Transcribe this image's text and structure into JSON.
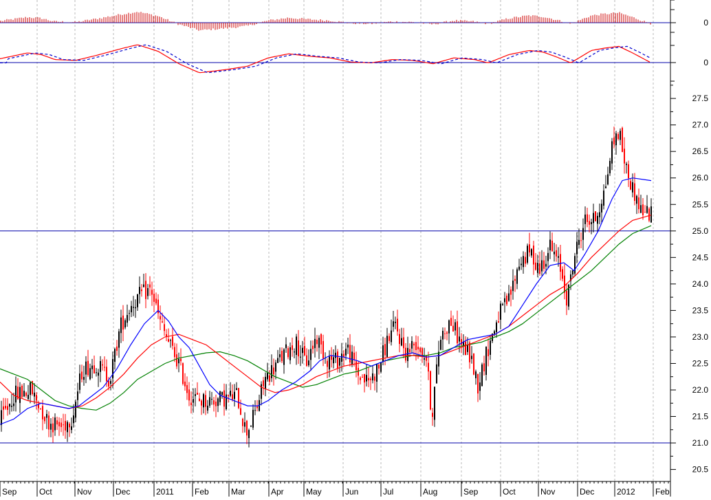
{
  "chart_data": {
    "type": "candlestick",
    "x_labels": [
      "Sep",
      "Oct",
      "Nov",
      "Dec",
      "2011",
      "Feb",
      "Mar",
      "Apr",
      "May",
      "Jun",
      "Jul",
      "Aug",
      "Sep",
      "Oct",
      "Nov",
      "Dec",
      "2012",
      "Feb"
    ],
    "price_axis": {
      "ylim": [
        20.3,
        27.8
      ],
      "ticks": [
        "20.5",
        "21.0",
        "21.5",
        "22.0",
        "22.5",
        "23.0",
        "23.5",
        "24.0",
        "24.5",
        "25.0",
        "25.5",
        "26.0",
        "26.5",
        "27.0",
        "27.5"
      ],
      "reference_lines": [
        21.0,
        25.0
      ]
    },
    "indicator_labels": [
      "0",
      "0"
    ],
    "grid": "vertical dashed",
    "colors": {
      "up_candle": "#000000",
      "down_candle": "#ff0000",
      "ma_short": "#0000ff",
      "ma_medium": "#ff0000",
      "ma_long": "#008000",
      "reference_line": "#0000aa",
      "histogram": "#cc0000",
      "signal_line": "#0000cc"
    },
    "ma_short_anchors": [
      [
        0,
        21.35
      ],
      [
        20,
        21.45
      ],
      [
        40,
        21.65
      ],
      [
        60,
        21.75
      ],
      [
        80,
        21.7
      ],
      [
        100,
        21.65
      ],
      [
        115,
        21.7
      ],
      [
        130,
        21.85
      ],
      [
        150,
        22.05
      ],
      [
        170,
        22.4
      ],
      [
        190,
        22.85
      ],
      [
        210,
        23.25
      ],
      [
        230,
        23.5
      ],
      [
        245,
        23.3
      ],
      [
        260,
        23.0
      ],
      [
        275,
        22.8
      ],
      [
        290,
        22.45
      ],
      [
        305,
        22.1
      ],
      [
        320,
        21.9
      ],
      [
        340,
        21.8
      ],
      [
        360,
        21.7
      ],
      [
        375,
        21.7
      ],
      [
        390,
        21.8
      ],
      [
        410,
        22.0
      ],
      [
        430,
        22.15
      ],
      [
        450,
        22.35
      ],
      [
        465,
        22.55
      ],
      [
        480,
        22.65
      ],
      [
        500,
        22.62
      ],
      [
        520,
        22.55
      ],
      [
        540,
        22.45
      ],
      [
        560,
        22.55
      ],
      [
        580,
        22.65
      ],
      [
        600,
        22.7
      ],
      [
        620,
        22.62
      ],
      [
        640,
        22.65
      ],
      [
        660,
        22.8
      ],
      [
        680,
        22.95
      ],
      [
        700,
        23.0
      ],
      [
        720,
        23.05
      ],
      [
        740,
        23.2
      ],
      [
        760,
        23.6
      ],
      [
        780,
        24.0
      ],
      [
        800,
        24.35
      ],
      [
        820,
        24.4
      ],
      [
        835,
        24.25
      ],
      [
        850,
        24.55
      ],
      [
        870,
        25.0
      ],
      [
        890,
        25.6
      ],
      [
        905,
        25.95
      ],
      [
        920,
        26.0
      ],
      [
        947,
        25.95
      ]
    ],
    "ma_medium_anchors": [
      [
        0,
        22.15
      ],
      [
        20,
        21.9
      ],
      [
        40,
        21.8
      ],
      [
        60,
        21.75
      ],
      [
        80,
        21.7
      ],
      [
        100,
        21.65
      ],
      [
        120,
        21.7
      ],
      [
        140,
        21.85
      ],
      [
        160,
        22.05
      ],
      [
        180,
        22.3
      ],
      [
        200,
        22.6
      ],
      [
        220,
        22.85
      ],
      [
        240,
        23.0
      ],
      [
        260,
        23.05
      ],
      [
        280,
        22.95
      ],
      [
        300,
        22.85
      ],
      [
        320,
        22.65
      ],
      [
        340,
        22.45
      ],
      [
        360,
        22.25
      ],
      [
        380,
        22.05
      ],
      [
        400,
        21.95
      ],
      [
        420,
        22.0
      ],
      [
        440,
        22.1
      ],
      [
        460,
        22.25
      ],
      [
        480,
        22.35
      ],
      [
        500,
        22.45
      ],
      [
        520,
        22.5
      ],
      [
        540,
        22.55
      ],
      [
        560,
        22.6
      ],
      [
        580,
        22.65
      ],
      [
        600,
        22.65
      ],
      [
        620,
        22.62
      ],
      [
        640,
        22.65
      ],
      [
        660,
        22.75
      ],
      [
        680,
        22.85
      ],
      [
        700,
        22.95
      ],
      [
        720,
        23.05
      ],
      [
        740,
        23.2
      ],
      [
        760,
        23.4
      ],
      [
        780,
        23.6
      ],
      [
        800,
        23.8
      ],
      [
        820,
        23.95
      ],
      [
        840,
        24.2
      ],
      [
        860,
        24.5
      ],
      [
        880,
        24.75
      ],
      [
        900,
        25.0
      ],
      [
        920,
        25.2
      ],
      [
        947,
        25.3
      ]
    ],
    "ma_long_anchors": [
      [
        0,
        22.4
      ],
      [
        20,
        22.3
      ],
      [
        40,
        22.2
      ],
      [
        60,
        22.0
      ],
      [
        80,
        21.8
      ],
      [
        100,
        21.7
      ],
      [
        120,
        21.65
      ],
      [
        140,
        21.62
      ],
      [
        160,
        21.75
      ],
      [
        180,
        21.95
      ],
      [
        200,
        22.2
      ],
      [
        220,
        22.35
      ],
      [
        240,
        22.5
      ],
      [
        260,
        22.6
      ],
      [
        280,
        22.65
      ],
      [
        300,
        22.7
      ],
      [
        320,
        22.72
      ],
      [
        340,
        22.65
      ],
      [
        360,
        22.55
      ],
      [
        380,
        22.4
      ],
      [
        400,
        22.25
      ],
      [
        420,
        22.15
      ],
      [
        440,
        22.05
      ],
      [
        460,
        22.1
      ],
      [
        480,
        22.2
      ],
      [
        500,
        22.3
      ],
      [
        520,
        22.35
      ],
      [
        540,
        22.45
      ],
      [
        560,
        22.55
      ],
      [
        580,
        22.6
      ],
      [
        600,
        22.65
      ],
      [
        620,
        22.65
      ],
      [
        640,
        22.7
      ],
      [
        660,
        22.8
      ],
      [
        680,
        22.85
      ],
      [
        700,
        22.9
      ],
      [
        720,
        23.0
      ],
      [
        740,
        23.1
      ],
      [
        760,
        23.25
      ],
      [
        780,
        23.45
      ],
      [
        800,
        23.65
      ],
      [
        820,
        23.85
      ],
      [
        840,
        24.05
      ],
      [
        860,
        24.25
      ],
      [
        880,
        24.5
      ],
      [
        900,
        24.75
      ],
      [
        920,
        24.95
      ],
      [
        947,
        25.1
      ]
    ],
    "price_anchors": [
      [
        0,
        21.4
      ],
      [
        20,
        21.9
      ],
      [
        45,
        22.0
      ],
      [
        70,
        21.4
      ],
      [
        90,
        21.3
      ],
      [
        105,
        21.5
      ],
      [
        120,
        22.4
      ],
      [
        140,
        22.5
      ],
      [
        160,
        22.2
      ],
      [
        175,
        23.2
      ],
      [
        190,
        23.6
      ],
      [
        205,
        23.8
      ],
      [
        220,
        23.9
      ],
      [
        232,
        23.3
      ],
      [
        245,
        22.9
      ],
      [
        260,
        22.5
      ],
      [
        275,
        21.9
      ],
      [
        290,
        21.8
      ],
      [
        310,
        21.8
      ],
      [
        330,
        21.85
      ],
      [
        345,
        21.9
      ],
      [
        358,
        21.2
      ],
      [
        372,
        21.6
      ],
      [
        385,
        22.2
      ],
      [
        400,
        22.45
      ],
      [
        415,
        22.7
      ],
      [
        430,
        22.9
      ],
      [
        445,
        22.5
      ],
      [
        460,
        23.0
      ],
      [
        475,
        22.6
      ],
      [
        490,
        22.55
      ],
      [
        505,
        22.8
      ],
      [
        520,
        22.3
      ],
      [
        535,
        22.15
      ],
      [
        550,
        22.4
      ],
      [
        565,
        23.0
      ],
      [
        575,
        23.2
      ],
      [
        590,
        22.7
      ],
      [
        605,
        22.9
      ],
      [
        620,
        22.6
      ],
      [
        628,
        21.5
      ],
      [
        640,
        23.0
      ],
      [
        655,
        23.3
      ],
      [
        670,
        22.9
      ],
      [
        685,
        22.6
      ],
      [
        695,
        22.1
      ],
      [
        710,
        22.8
      ],
      [
        725,
        23.4
      ],
      [
        740,
        23.7
      ],
      [
        755,
        24.4
      ],
      [
        770,
        24.6
      ],
      [
        785,
        24.3
      ],
      [
        800,
        24.7
      ],
      [
        815,
        24.3
      ],
      [
        825,
        23.7
      ],
      [
        835,
        24.5
      ],
      [
        850,
        25.2
      ],
      [
        865,
        25.2
      ],
      [
        880,
        25.8
      ],
      [
        890,
        26.6
      ],
      [
        900,
        26.9
      ],
      [
        910,
        26.2
      ],
      [
        920,
        25.8
      ],
      [
        932,
        25.4
      ],
      [
        947,
        25.3
      ]
    ],
    "macd_anchors": [
      [
        0,
        0.3
      ],
      [
        40,
        1.0
      ],
      [
        60,
        0.8
      ],
      [
        80,
        0.2
      ],
      [
        110,
        0.1
      ],
      [
        140,
        0.7
      ],
      [
        180,
        1.6
      ],
      [
        200,
        2.0
      ],
      [
        230,
        1.2
      ],
      [
        260,
        -0.3
      ],
      [
        290,
        -1.4
      ],
      [
        330,
        -1.0
      ],
      [
        360,
        -0.6
      ],
      [
        390,
        0.4
      ],
      [
        420,
        0.9
      ],
      [
        450,
        0.6
      ],
      [
        480,
        0.4
      ],
      [
        510,
        -0.1
      ],
      [
        540,
        -0.2
      ],
      [
        570,
        0.2
      ],
      [
        600,
        0.1
      ],
      [
        630,
        -0.3
      ],
      [
        660,
        0.4
      ],
      [
        690,
        0.2
      ],
      [
        710,
        -0.2
      ],
      [
        740,
        0.8
      ],
      [
        770,
        1.3
      ],
      [
        790,
        1.1
      ],
      [
        810,
        0.5
      ],
      [
        830,
        -0.2
      ],
      [
        860,
        1.3
      ],
      [
        880,
        1.6
      ],
      [
        900,
        1.8
      ],
      [
        920,
        1.0
      ],
      [
        947,
        -0.2
      ]
    ]
  }
}
